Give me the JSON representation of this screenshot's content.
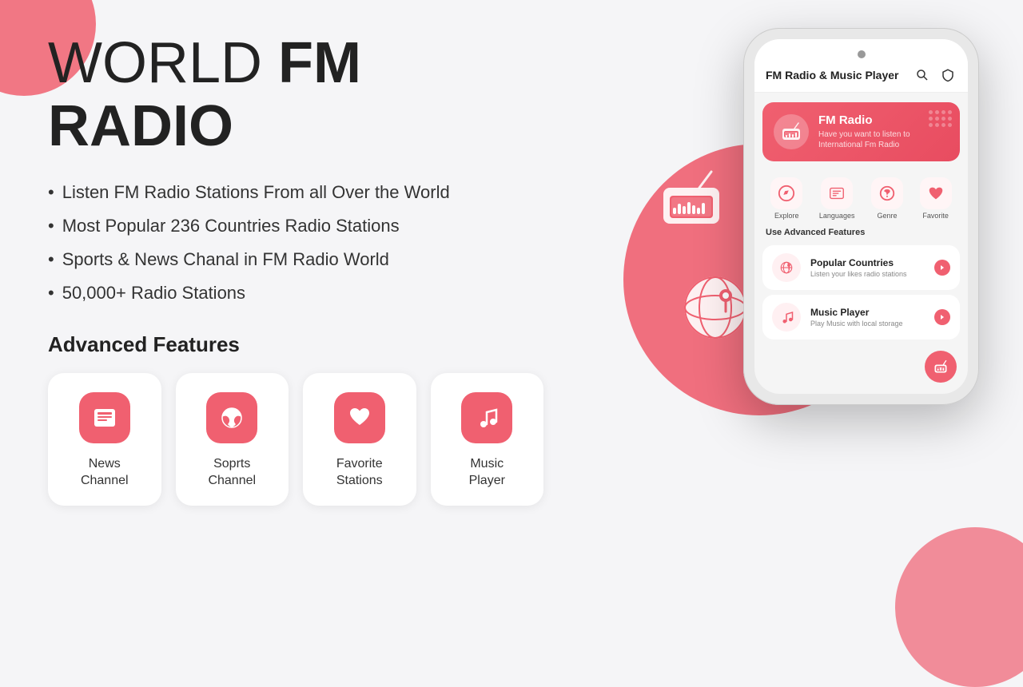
{
  "title": {
    "part1": "WORLD ",
    "part2": "FM RADIO"
  },
  "bullets": [
    "Listen FM Radio Stations From all Over the World",
    "Most Popular 236 Countries Radio Stations",
    "Sports & News Chanal in FM Radio World",
    "50,000+ Radio Stations"
  ],
  "advanced_features_label": "Advanced Features",
  "feature_cards": [
    {
      "label": "News\nChannel",
      "icon": "news"
    },
    {
      "label": "Soprts\nChannel",
      "icon": "sports"
    },
    {
      "label": "Favorite\nStations",
      "icon": "favorite"
    },
    {
      "label": "Music\nPlayer",
      "icon": "music"
    }
  ],
  "app": {
    "header_title": "FM Radio & Music Player",
    "banner": {
      "title": "FM Radio",
      "subtitle": "Have you want to listen to\nInternational Fm Radio"
    },
    "nav": [
      {
        "label": "Explore"
      },
      {
        "label": "Languages"
      },
      {
        "label": "Genre"
      },
      {
        "label": "Favorite"
      }
    ],
    "section_label": "Use Advanced Features",
    "rows": [
      {
        "title": "Popular Countries",
        "subtitle": "Listen your likes radio stations"
      },
      {
        "title": "Music Player",
        "subtitle": "Play Music with local storage"
      }
    ]
  }
}
